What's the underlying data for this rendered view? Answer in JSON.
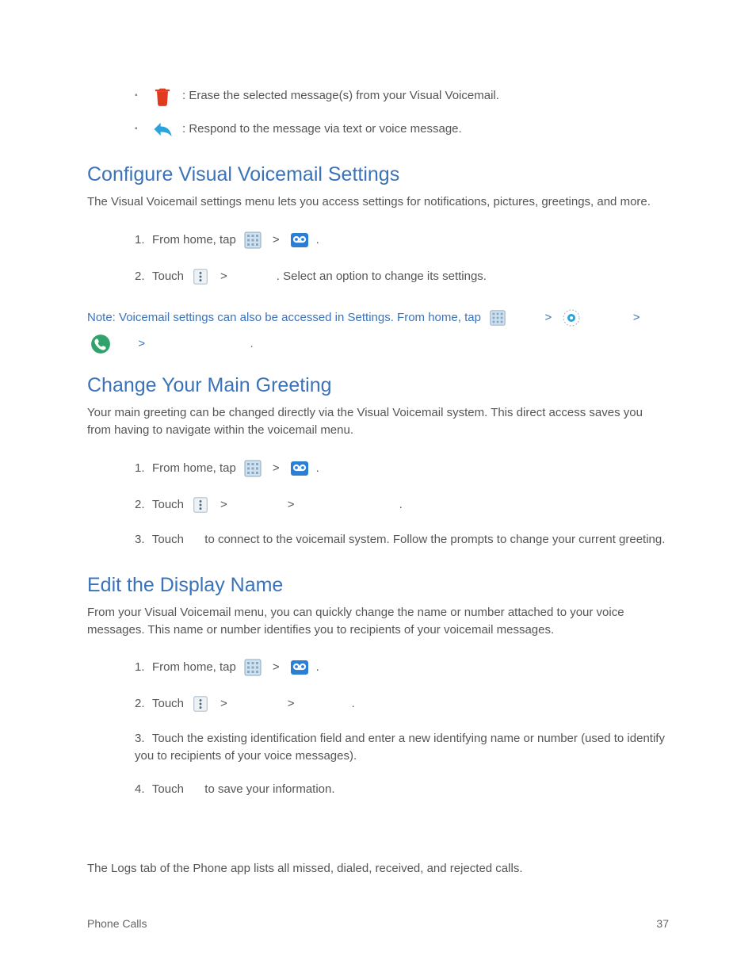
{
  "bullets": [
    {
      "text": ": Erase the selected message(s) from your Visual Voicemail."
    },
    {
      "text": ": Respond to the message via text or voice message."
    }
  ],
  "sections": {
    "configure": {
      "heading": "Configure Visual Voicemail Settings",
      "intro": "The Visual Voicemail settings menu lets you access settings for notifications, pictures, greetings, and more.",
      "step1_prefix_num": "1.",
      "step1_prefix": "From home, tap ",
      "step2_num": "2.",
      "step2_a": "Touch ",
      "step2_b": ". Select an option to change its settings.",
      "note_a": "Note: Voicemail settings can also be accessed in Settings. From home, tap ",
      "gt": ">",
      "period": "."
    },
    "greeting": {
      "heading": "Change Your Main Greeting",
      "intro": "Your main greeting can be changed directly via the Visual Voicemail system. This direct access saves you from having to navigate within the voicemail menu.",
      "step1_num": "1.",
      "step1_prefix": "From home, tap ",
      "step2_num": "2.",
      "step2_a": "Touch ",
      "step3_num": "3.",
      "step3_a": "Touch ",
      "step3_b": " to connect to the voicemail system. Follow the prompts to change your current greeting."
    },
    "display": {
      "heading": "Edit the Display Name",
      "intro": "From your Visual Voicemail menu, you can quickly change the name or number attached to your voice messages. This name or number identifies you to recipients of your voicemail messages.",
      "step1_num": "1.",
      "step1_prefix": "From home, tap ",
      "step2_num": "2.",
      "step2_a": "Touch ",
      "step3_num": "3.",
      "step3": "Touch the existing identification field and enter a new identifying name or number (used to identify you to recipients of your voice messages).",
      "step4_num": "4.",
      "step4_a": "Touch ",
      "step4_b": " to save your information."
    }
  },
  "logs_text": "The Logs tab of the Phone app lists all missed, dialed, received, and rejected calls.",
  "footer": {
    "left": "Phone Calls",
    "right": "37"
  },
  "glyphs": {
    "gt": ">",
    "period": ".",
    "space": " "
  }
}
